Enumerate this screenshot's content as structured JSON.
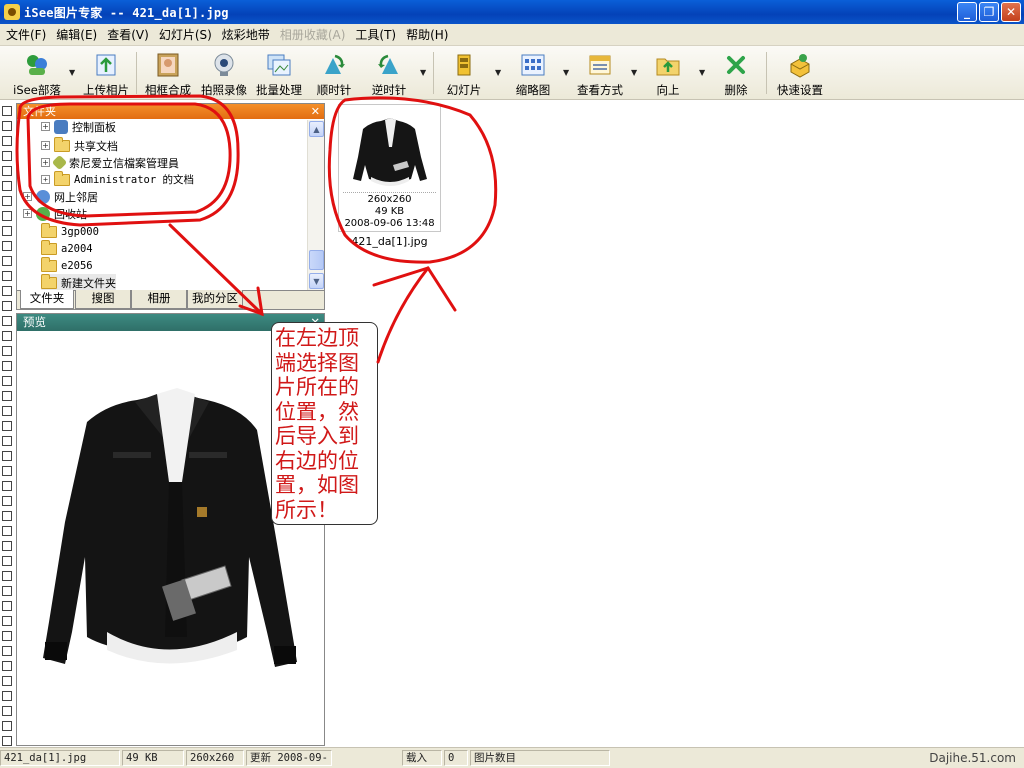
{
  "window": {
    "title": "iSee图片专家 -- 421_da[1].jpg",
    "buttons": {
      "minimize": "_",
      "restore": "❐",
      "close": "✕"
    }
  },
  "menu": [
    "文件(F)",
    "编辑(E)",
    "查看(V)",
    "幻灯片(S)",
    "炫彩地带",
    "相册收藏(A)",
    "工具(T)",
    "帮助(H)"
  ],
  "toolbar": {
    "isee_tribe": "iSee部落",
    "upload": "上传相片",
    "frame": "相框合成",
    "camera": "拍照录像",
    "batch": "批量处理",
    "clockwise": "顺时针",
    "counterclockwise": "逆时针",
    "slideshow": "幻灯片",
    "thumbnail": "缩略图",
    "view_mode": "查看方式",
    "up": "向上",
    "delete": "删除",
    "quick_settings": "快速设置"
  },
  "folder_panel": {
    "title": "文件夹",
    "close": "✕",
    "tree": [
      "控制面板",
      "共享文档",
      "索尼爱立信檔案管理員",
      "Administrator 的文档",
      "网上邻居",
      "回收站",
      "3gp000",
      "a2004",
      "e2056",
      "新建文件夹"
    ],
    "tabs": [
      "文件夹",
      "搜图",
      "相册",
      "我的分区"
    ]
  },
  "preview_panel": {
    "title": "预览",
    "close": "✕"
  },
  "thumbnail": {
    "dimensions": "260x260",
    "size": "49 KB",
    "date": "2008-09-06 13:48",
    "filename": "421_da[1].jpg"
  },
  "annotation": {
    "text": "在左边顶端选择图片所在的位置，然后导入到右边的位置，如图所示！"
  },
  "statusbar": {
    "filename": "421_da[1].jpg",
    "size": "49 KB",
    "dimensions": "260x260",
    "updated": "更新 2008-09-",
    "segment4": "载入",
    "segment5": "0",
    "segment6": "图片数目",
    "watermark": "Dajihe.51.com"
  },
  "colors": {
    "annotation_red": "#d01818",
    "folder_header": "#e87b1e",
    "preview_header": "#357a73",
    "title_blue": "#0a54c9"
  }
}
